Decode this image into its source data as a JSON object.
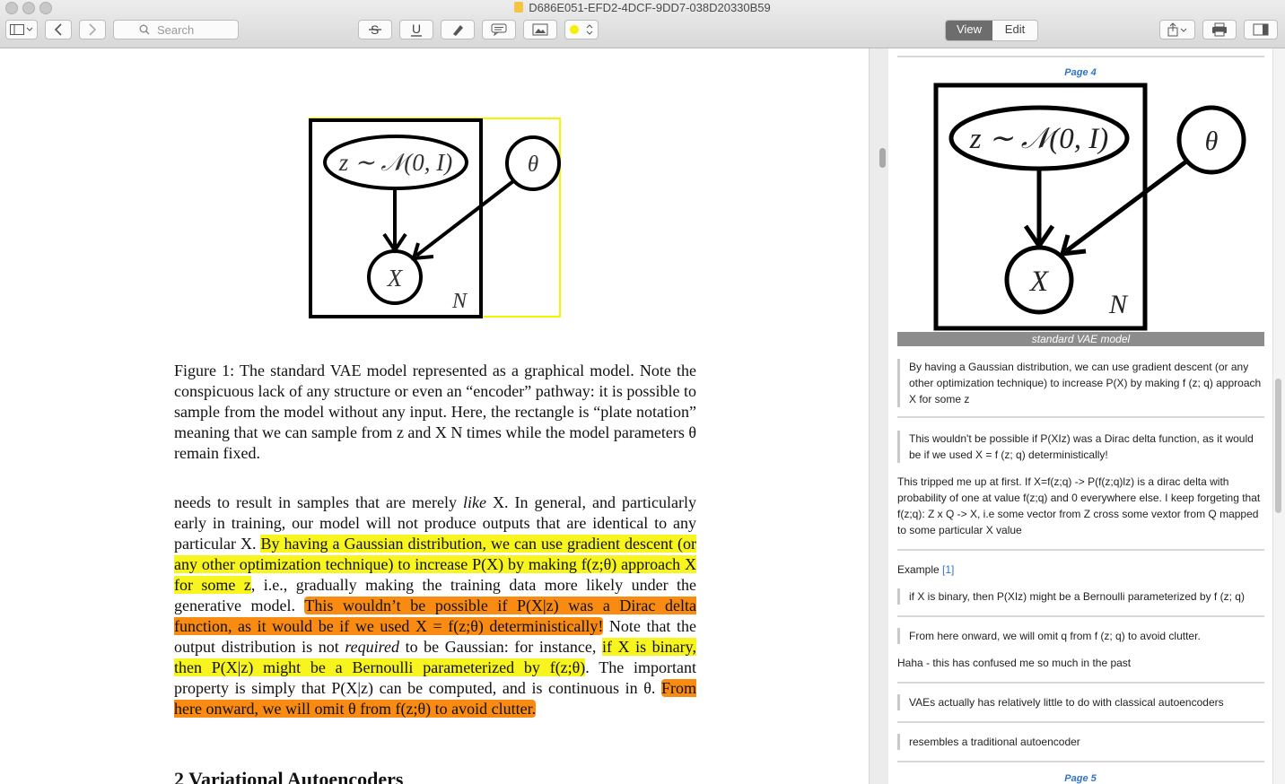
{
  "window": {
    "title": "D686E051-EFD2-4DCF-9DD7-038D20330B59"
  },
  "toolbar": {
    "search_placeholder": "Search",
    "view_label": "View",
    "edit_label": "Edit",
    "highlight_color": "#f7f51d"
  },
  "figure": {
    "latent_label": "z ∼ 𝒩(0, I)",
    "param_label": "θ",
    "observed_label": "X",
    "plate_label": "N"
  },
  "document": {
    "caption": "Figure 1: The standard VAE model represented as a graphical model. Note the conspicuous lack of any structure or even an “encoder” pathway: it is possible to sample from the model without any input. Here, the rectangle is “plate notation” meaning that we can sample from z and X N times while the model parameters θ remain fixed.",
    "para_part1": "needs to result in samples that are merely ",
    "para_like": "like",
    "para_part2": " X. In general, and particularly early in training, our model will not produce outputs that are identical to any particular X. ",
    "hl1": "By having a Gaussian distribution, we can use gradient descent (or any other optimization technique) to increase P(X) by making f(z;θ) approach X for some z",
    "para_part3": ", i.e., gradually making the training data more likely under the generative model. ",
    "hl2": "This wouldn’t be possible if P(X|z) was a Dirac delta function, as it would be if we used X = f(z;θ) deterministically!",
    "para_part4": " Note that the output distribution is not ",
    "para_required": "required",
    "para_part5": " to be Gaussian: for instance, ",
    "hl3": "if X is binary, then P(X|z) might be a Bernoulli parameterized by f(z;θ)",
    "para_part6": ". The important property is simply that P(X|z) can be computed, and is continuous in θ. ",
    "hl4": "From here onward, we will omit θ from f(z;θ) to avoid clutter.",
    "section_heading": "2 Variational Autoencoders"
  },
  "notes": {
    "page4_label": "Page 4",
    "thumb_caption": "standard VAE model",
    "q1": "By having a Gaussian distribution, we can use gradient descent (or any other optimization technique) to increase P(X) by making f (z; q) approach X for some z",
    "q2": "This wouldn't be possible if P(XIz) was a Dirac delta function, as it would be if we used X = f (z; q) deterministically!",
    "c2": "This tripped me up at first. If X=f(z;q) -> P(f(z;q)lz) is a dirac delta with probability of one at value f(z;q) and 0 everywhere else. I keep forgeting that f(z;q): Z x Q -> X, i.e some vector from Z cross some vextor from Q mapped to some particular X value",
    "example_label": "Example",
    "example_ref": "[1]",
    "q3": "if X is binary, then P(XIz) might be a Bernoulli parameterized by f (z; q)",
    "q4": "From here onward, we will omit q from f (z; q) to avoid clutter.",
    "c4": "Haha - this has confused me so much in the past",
    "q5": "VAEs actually has relatively little to do with classical autoencoders",
    "q6": "resembles a traditional autoencoder",
    "page5_label": "Page 5"
  }
}
